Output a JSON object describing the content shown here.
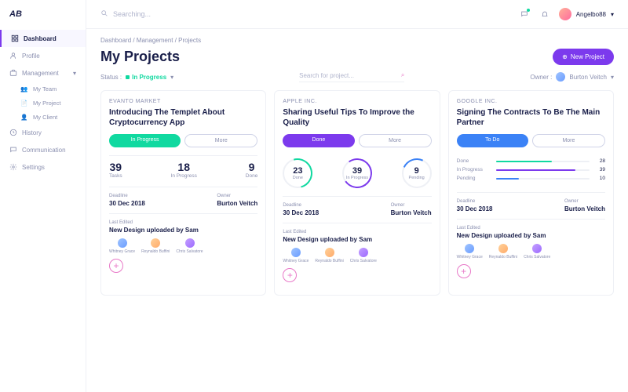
{
  "logo": "AB",
  "topbar": {
    "search_placeholder": "Searching...",
    "username": "Angelbo88"
  },
  "sidebar": {
    "items": [
      {
        "label": "Dashboard"
      },
      {
        "label": "Profile"
      },
      {
        "label": "Management"
      },
      {
        "label": "My Team"
      },
      {
        "label": "My Project"
      },
      {
        "label": "My Client"
      },
      {
        "label": "History"
      },
      {
        "label": "Communication"
      },
      {
        "label": "Settings"
      }
    ]
  },
  "breadcrumb": "Dashboard  /  Management  /  Projects",
  "page_title": "My Projects",
  "new_project_btn": "New Project",
  "filters": {
    "status_label": "Status :",
    "status_value": "In Progress",
    "search_placeholder": "Search for project...",
    "owner_label": "Owner :",
    "owner_value": "Burton Veitch"
  },
  "cards": [
    {
      "company": "EVANTO MARKET",
      "title": "Introducing The Templet About Cryptocurrency App",
      "status_btn": "In Progress",
      "more_btn": "More",
      "stats": [
        {
          "num": "39",
          "lbl": "Tasks"
        },
        {
          "num": "18",
          "lbl": "In Progress"
        },
        {
          "num": "9",
          "lbl": "Done"
        }
      ],
      "deadline_lbl": "Deadline",
      "deadline": "30 Dec 2018",
      "owner_lbl": "Owner",
      "owner": "Burton Veitch",
      "edited_lbl": "Last Edited",
      "edited": "New Design uploaded by Sam",
      "people": [
        "Whitney Grace",
        "Reynaldo Buffini",
        "Chris Salvatore"
      ]
    },
    {
      "company": "APPLE INC.",
      "title": "Sharing Useful Tips To Improve the Quality",
      "status_btn": "Done",
      "more_btn": "More",
      "stats": [
        {
          "num": "23",
          "lbl": "Done"
        },
        {
          "num": "39",
          "lbl": "In Progress"
        },
        {
          "num": "9",
          "lbl": "Pending"
        }
      ],
      "deadline_lbl": "Deadline",
      "deadline": "30 Dec 2018",
      "owner_lbl": "Owner",
      "owner": "Burton Veitch",
      "edited_lbl": "Last Edited",
      "edited": "New Design uploaded by Sam",
      "people": [
        "Whitney Grace",
        "Reynaldo Buffini",
        "Chris Salvatore"
      ]
    },
    {
      "company": "GOOGLE INC.",
      "title": "Signing The Contracts To Be The Main Partner",
      "status_btn": "To Do",
      "more_btn": "More",
      "bars": [
        {
          "lbl": "Done",
          "val": "28",
          "w": "60",
          "color": "#10d9a0"
        },
        {
          "lbl": "In Progress",
          "val": "39",
          "w": "85",
          "color": "#7c3aed"
        },
        {
          "lbl": "Pending",
          "val": "10",
          "w": "25",
          "color": "#3b82f6"
        }
      ],
      "deadline_lbl": "Deadline",
      "deadline": "30 Dec 2018",
      "owner_lbl": "Owner",
      "owner": "Burton Veitch",
      "edited_lbl": "Last Edited",
      "edited": "New Design uploaded by Sam",
      "people": [
        "Whitney Grace",
        "Reynaldo Buffini",
        "Chris Salvatore"
      ]
    }
  ]
}
